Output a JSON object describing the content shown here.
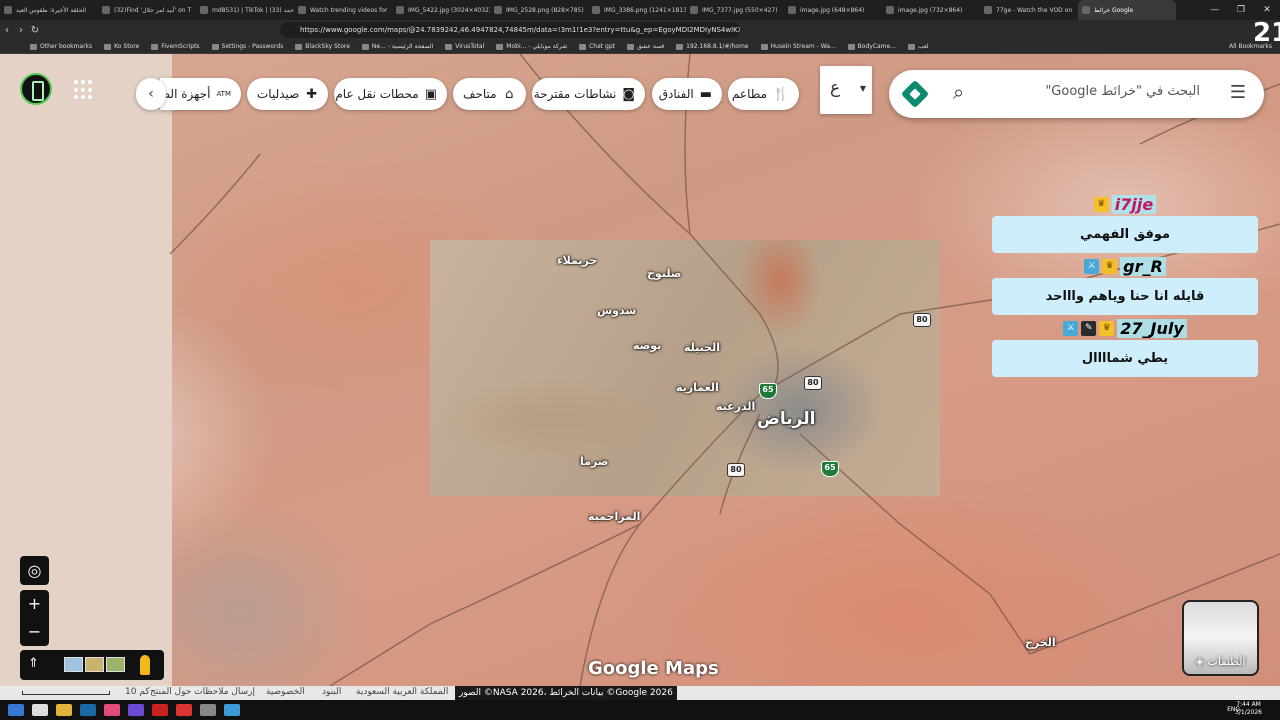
{
  "browser": {
    "tabs": [
      {
        "title": "الحلقة الأخيرة: طقوس العيد",
        "active": false
      },
      {
        "title": "(32)Find 'أبيد لمر حلال' on T",
        "active": false
      },
      {
        "title": "md8531) | TikTok | حمد (33)",
        "active": false
      },
      {
        "title": "Watch trending videos for",
        "active": false
      },
      {
        "title": "IMG_5422.jpg (3024×4032)",
        "active": false
      },
      {
        "title": "IMG_2528.png (828×785)",
        "active": false
      },
      {
        "title": "IMG_3386.png (1241×1813)",
        "active": false
      },
      {
        "title": "IMG_7377.jpg (550×427)",
        "active": false
      },
      {
        "title": "image.jpg (648×864)",
        "active": false
      },
      {
        "title": "image.jpg (732×864)",
        "active": false
      },
      {
        "title": "77ge - Watch the VOD on",
        "active": false
      },
      {
        "title": "خرائط Google",
        "active": true
      }
    ],
    "url": "https://www.google.com/maps/@24.7839242,46.4947824,74845m/data=!3m1!1e3?entry=ttu&g_ep=EgoyMDI2MDIyNS4wIKXMDSoASAF...",
    "bookmarks": [
      "Other bookmarks",
      "Ko Store",
      "FivemScripts",
      "Settings - Passwords",
      "BlackSky Store",
      "Ne... - الصفحة الرئيسية",
      "VirusTotal",
      "Mobi... - شركة موبايلي",
      "Chat gpt",
      "قصة عشق",
      "192.168.8.1/#/home",
      "Husein Stream - Wa...",
      "BodyCame...",
      "لعب"
    ],
    "all_bookmarks": "All Bookmarks"
  },
  "search": {
    "placeholder": "البحث في \"خرائط Google\"",
    "lang_char": "ع"
  },
  "chips": [
    {
      "label": "مطاعم",
      "icon": "fork-knife-icon"
    },
    {
      "label": "الفنادق",
      "icon": "bed-icon"
    },
    {
      "label": "نشاطات مقترحة",
      "icon": "camera-icon"
    },
    {
      "label": "متاحف",
      "icon": "museum-icon"
    },
    {
      "label": "محطات نقل عام",
      "icon": "bus-icon"
    },
    {
      "label": "صيدليات",
      "icon": "pharmacy-icon"
    },
    {
      "label": "أجهزة الص",
      "icon": "atm-icon",
      "prefix": "ATM"
    }
  ],
  "map_labels": {
    "riyadh": "الرياض",
    "huraymila": "حريملاء",
    "salbukh": "صلبوخ",
    "sadus": "سدوس",
    "bawdah": "بوضة",
    "aljubailah": "الجبيلة",
    "alammariyah": "العمارية",
    "diriyah": "الدرعية",
    "dhurma": "ضرما",
    "muzahmiyah": "المزاحمية",
    "kharj": "الخرج"
  },
  "road_shields": [
    "80",
    "80",
    "80",
    "65",
    "65"
  ],
  "chat": [
    {
      "user": "i7jje",
      "message": "موفق الفهمي",
      "color": "#c2185b"
    },
    {
      "user": "gr_R",
      "message": "قايله انا حنا وياهم واااحد",
      "color": "#1a1a1a"
    },
    {
      "user": "27_July",
      "message": "يطي شماااال",
      "color": "#1a1a1a"
    }
  ],
  "layers_label": "الطبقات",
  "watermark": "Google Maps",
  "footer": {
    "scale": "10 كم",
    "links": [
      "إرسال ملاحظات حول المنتج",
      "الخصوصية",
      "البنود",
      "المملكة العربية السعودية"
    ],
    "copyright": "الصور ©NASA 2026، بيانات الخرائط ©Google 2026"
  },
  "taskbar": {
    "lang": "ENG",
    "time": "7:44 AM",
    "date": "3/1/2026"
  },
  "overlay_number": "21"
}
